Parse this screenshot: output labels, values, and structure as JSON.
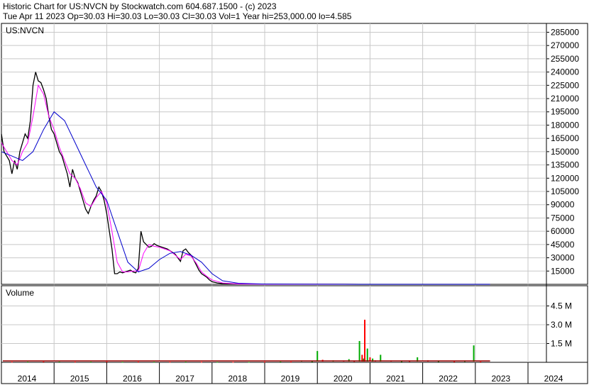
{
  "header": {
    "line1": "Historic Chart for US:NVCN by Stockwatch.com 604.687.1500 - (c) 2023",
    "line2": "Tue Apr 11 2023   Op=30.03   Hi=30.03   Lo=30.03   Cl=30.03   Vol=1   Year hi=253,000.00   lo=4.585"
  },
  "chart_data": [
    {
      "type": "line",
      "title": "US:NVCN",
      "y_ticks": [
        15000,
        30000,
        45000,
        60000,
        75000,
        90000,
        105000,
        120000,
        135000,
        150000,
        165000,
        180000,
        195000,
        210000,
        225000,
        240000,
        255000,
        270000,
        285000
      ],
      "y_tick_labels": [
        "15000",
        "30000",
        "45000",
        "60000",
        "75000",
        "90000",
        "105000",
        "120000",
        "135000",
        "150000",
        "165000",
        "180000",
        "195000",
        "210000",
        "225000",
        "240000",
        "255000",
        "270000",
        "285000"
      ],
      "ylim": [
        0,
        295000
      ],
      "xlim": [
        2014.0,
        2024.35
      ],
      "x_ticks": [
        2014,
        2015,
        2016,
        2017,
        2018,
        2019,
        2020,
        2021,
        2022,
        2023,
        2024
      ],
      "x_tick_labels": [
        "2014",
        "2015",
        "2016",
        "2017",
        "2018",
        "2019",
        "2020",
        "2021",
        "2022",
        "2023",
        "2024"
      ],
      "grid": true,
      "series": [
        {
          "color": "#000000",
          "x": [
            2014.0,
            2014.05,
            2014.1,
            2014.15,
            2014.2,
            2014.25,
            2014.3,
            2014.35,
            2014.4,
            2014.45,
            2014.5,
            2014.55,
            2014.6,
            2014.65,
            2014.7,
            2014.75,
            2014.8,
            2014.85,
            2014.9,
            2014.95,
            2015.0,
            2015.05,
            2015.1,
            2015.15,
            2015.2,
            2015.25,
            2015.3,
            2015.35,
            2015.4,
            2015.45,
            2015.5,
            2015.55,
            2015.6,
            2015.65,
            2015.7,
            2015.75,
            2015.8,
            2015.85,
            2015.9,
            2015.95,
            2016.0,
            2016.05,
            2016.1,
            2016.15,
            2016.2,
            2016.25,
            2016.3,
            2016.35,
            2016.4,
            2016.45,
            2016.5,
            2016.55,
            2016.6,
            2016.65,
            2016.7,
            2016.75,
            2016.8,
            2016.85,
            2016.9,
            2016.95,
            2017.0,
            2017.05,
            2017.1,
            2017.15,
            2017.2,
            2017.25,
            2017.3,
            2017.35,
            2017.4,
            2017.45,
            2017.5,
            2017.55,
            2017.6,
            2017.65,
            2017.7,
            2017.75,
            2017.8,
            2017.85,
            2017.9,
            2017.95,
            2018.0,
            2018.1,
            2018.2,
            2018.4,
            2018.6,
            2019.0,
            2019.5,
            2020.0,
            2020.5,
            2021.0,
            2021.5,
            2022.0,
            2022.5,
            2023.0,
            2023.28
          ],
          "values": [
            170000,
            150000,
            145000,
            140000,
            125000,
            140000,
            130000,
            150000,
            160000,
            170000,
            165000,
            185000,
            225000,
            240000,
            230000,
            228000,
            220000,
            210000,
            190000,
            175000,
            170000,
            160000,
            150000,
            145000,
            135000,
            125000,
            110000,
            130000,
            120000,
            115000,
            105000,
            95000,
            85000,
            80000,
            88000,
            95000,
            100000,
            110000,
            105000,
            95000,
            80000,
            60000,
            40000,
            12000,
            12000,
            14000,
            13000,
            14000,
            15000,
            16000,
            14000,
            13000,
            18000,
            60000,
            48000,
            45000,
            42000,
            43000,
            46000,
            44000,
            43000,
            42000,
            41000,
            40000,
            38000,
            36000,
            34000,
            30000,
            26000,
            38000,
            40000,
            36000,
            33000,
            28000,
            22000,
            16000,
            12000,
            10000,
            8000,
            5000,
            3000,
            1500,
            800,
            500,
            300,
            200,
            100,
            60,
            50,
            40,
            35,
            32,
            31,
            30,
            30.03
          ]
        },
        {
          "color": "#ff00ff",
          "x": [
            2014.0,
            2014.1,
            2014.2,
            2014.3,
            2014.4,
            2014.5,
            2014.6,
            2014.7,
            2014.8,
            2014.9,
            2015.0,
            2015.1,
            2015.2,
            2015.3,
            2015.4,
            2015.5,
            2015.6,
            2015.7,
            2015.8,
            2015.9,
            2016.0,
            2016.1,
            2016.2,
            2016.3,
            2016.4,
            2016.5,
            2016.6,
            2016.7,
            2016.8,
            2016.9,
            2017.0,
            2017.1,
            2017.2,
            2017.3,
            2017.4,
            2017.5,
            2017.6,
            2017.7,
            2017.8,
            2017.9,
            2018.0,
            2018.2,
            2018.5,
            2019.0,
            2020.0,
            2021.0,
            2022.0,
            2023.28
          ],
          "values": [
            160000,
            150000,
            140000,
            135000,
            150000,
            160000,
            190000,
            225000,
            215000,
            190000,
            175000,
            155000,
            140000,
            125000,
            120000,
            108000,
            92000,
            88000,
            98000,
            105000,
            92000,
            60000,
            25000,
            14000,
            14000,
            15000,
            15000,
            35000,
            45000,
            43000,
            42000,
            40000,
            38000,
            33000,
            28000,
            34000,
            32000,
            24000,
            14000,
            9000,
            5000,
            1500,
            400,
            120,
            50,
            35,
            31,
            30
          ]
        },
        {
          "color": "#0000cc",
          "x": [
            2014.0,
            2014.2,
            2014.4,
            2014.6,
            2014.8,
            2015.0,
            2015.2,
            2015.4,
            2015.6,
            2015.8,
            2016.0,
            2016.2,
            2016.4,
            2016.6,
            2016.8,
            2017.0,
            2017.2,
            2017.4,
            2017.6,
            2017.8,
            2018.0,
            2018.2,
            2018.5,
            2019.0,
            2020.0,
            2021.0,
            2022.0,
            2023.28
          ],
          "values": [
            150000,
            145000,
            140000,
            150000,
            175000,
            195000,
            185000,
            160000,
            135000,
            110000,
            95000,
            60000,
            25000,
            14000,
            18000,
            28000,
            35000,
            37000,
            33000,
            25000,
            12000,
            4000,
            1200,
            300,
            80,
            40,
            32,
            30
          ]
        }
      ]
    },
    {
      "type": "bar",
      "title": "Volume",
      "y_ticks": [
        1500000,
        3000000,
        4500000
      ],
      "y_tick_labels": [
        "1.5 M",
        "3.0 M",
        "4.5 M"
      ],
      "ylim": [
        0,
        6000000
      ],
      "xlim": [
        2014.0,
        2024.35
      ],
      "grid": true,
      "series": [
        {
          "name": "volume",
          "x": [
            2014.2,
            2014.5,
            2014.8,
            2015.1,
            2015.4,
            2015.7,
            2016.0,
            2016.3,
            2016.6,
            2016.9,
            2017.2,
            2017.5,
            2017.8,
            2018.1,
            2018.4,
            2018.7,
            2019.0,
            2019.3,
            2019.5,
            2019.7,
            2019.9,
            2020.0,
            2020.1,
            2020.3,
            2020.5,
            2020.6,
            2020.7,
            2020.8,
            2020.85,
            2020.88,
            2020.9,
            2020.95,
            2021.0,
            2021.05,
            2021.1,
            2021.2,
            2021.4,
            2021.6,
            2021.75,
            2021.9,
            2022.1,
            2022.3,
            2022.6,
            2022.8,
            2022.97,
            2023.1
          ],
          "values": [
            40000,
            50000,
            60000,
            55000,
            45000,
            50000,
            60000,
            40000,
            50000,
            45000,
            40000,
            50000,
            35000,
            40000,
            30000,
            35000,
            40000,
            60000,
            50000,
            120000,
            80000,
            900000,
            200000,
            150000,
            120000,
            250000,
            100000,
            1700000,
            600000,
            300000,
            3400000,
            1100000,
            400000,
            300000,
            150000,
            600000,
            120000,
            80000,
            100000,
            400000,
            150000,
            90000,
            70000,
            100000,
            1350000,
            60000
          ],
          "colors": [
            "#ff0000",
            "#00aa00",
            "#ff0000",
            "#00aa00",
            "#ff0000",
            "#00aa00",
            "#ff0000",
            "#00aa00",
            "#ff0000",
            "#00aa00",
            "#ff0000",
            "#00aa00",
            "#ff0000",
            "#00aa00",
            "#ff0000",
            "#00aa00",
            "#ff0000",
            "#00aa00",
            "#ff0000",
            "#00aa00",
            "#00aa00",
            "#00aa00",
            "#ff0000",
            "#00aa00",
            "#ff0000",
            "#00aa00",
            "#ff0000",
            "#00aa00",
            "#ff0000",
            "#00aa00",
            "#ff0000",
            "#00aa00",
            "#ff0000",
            "#00aa00",
            "#ff0000",
            "#00aa00",
            "#ff0000",
            "#00aa00",
            "#ff0000",
            "#00aa00",
            "#ff0000",
            "#00aa00",
            "#ff0000",
            "#00aa00",
            "#00aa00",
            "#ff0000"
          ]
        }
      ]
    }
  ]
}
